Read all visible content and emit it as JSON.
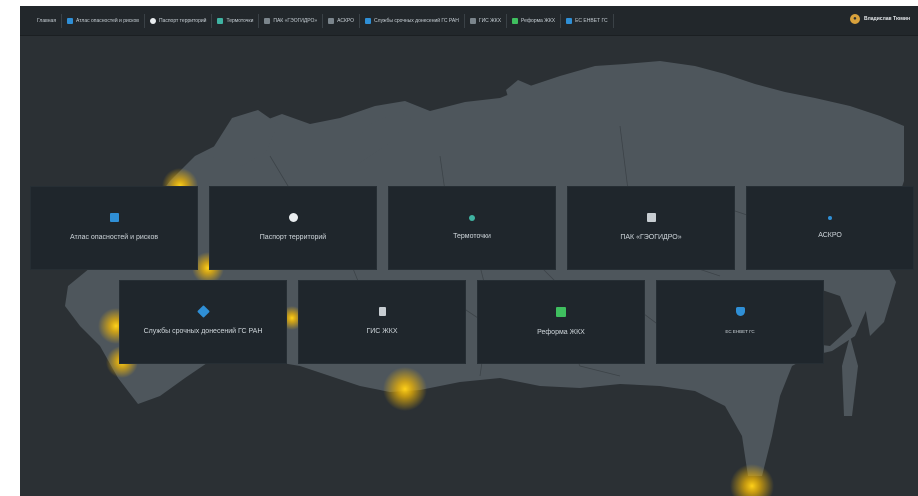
{
  "nav": {
    "items": [
      {
        "label": "Главная",
        "icon": "home-icon",
        "color": ""
      },
      {
        "label": "Атлас опасностей и рисков",
        "icon": "atlas-icon",
        "color": "#2f8fd6"
      },
      {
        "label": "Паспорт территорий",
        "icon": "passport-icon",
        "color": "#e9edf0"
      },
      {
        "label": "Термоточки",
        "icon": "thermal-point-icon",
        "color": "#3fb3a2"
      },
      {
        "label": "ПАК «ГЭОГИДРО»",
        "icon": "geohydro-icon",
        "color": "#7b858c"
      },
      {
        "label": "АСКРО",
        "icon": "askro-icon",
        "color": "#7b858c"
      },
      {
        "label": "Службы срочных донесений ГС РАН",
        "icon": "urgent-reports-icon",
        "color": "#2f8fd6"
      },
      {
        "label": "ГИС ЖКХ",
        "icon": "gis-icon",
        "color": "#7b858c"
      },
      {
        "label": "Реформа ЖКХ",
        "icon": "reform-icon",
        "color": "#3fbf5f"
      },
      {
        "label": "ЕС ЕНВЕТ ГС",
        "icon": "shield-icon",
        "color": "#2f8fd6"
      }
    ],
    "user_name": "Владислав Тюмин"
  },
  "cards": [
    {
      "label": "Атлас опасностей и рисков",
      "icon": "atlas-icon",
      "color": "#2f8fd6"
    },
    {
      "label": "Паспорт территорий",
      "icon": "passport-icon",
      "color": "#e9edf0"
    },
    {
      "label": "Термоточки",
      "icon": "thermal-point-icon",
      "color": "#3fb3a2"
    },
    {
      "label": "ПАК «ГЭОГИДРО»",
      "icon": "geohydro-icon",
      "color": "#c7cdd2"
    },
    {
      "label": "АСКРО",
      "icon": "askro-icon",
      "color": "#2f8fd6"
    },
    {
      "label": "Службы срочных донесений ГС РАН",
      "icon": "urgent-reports-icon",
      "color": "#2f8fd6"
    },
    {
      "label": "ГИС ЖКХ",
      "icon": "gis-icon",
      "color": "#c7cdd2"
    },
    {
      "label": "Реформа ЖКХ",
      "icon": "reform-icon",
      "color": "#3fbf5f"
    },
    {
      "label": "ЕС ЕНВЕТ ГС",
      "icon": "shield-icon",
      "color": "#2f8fd6"
    }
  ],
  "theme": {
    "background": "#2b3034",
    "land": "#4e565c",
    "card": "#1f262c",
    "hotspot": "#f2b705"
  }
}
